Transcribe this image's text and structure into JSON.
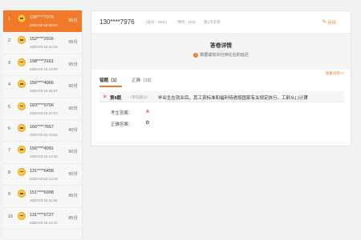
{
  "sidebar": {
    "items": [
      {
        "rank": "1",
        "phone": "130****7976",
        "date": "2020-03-15 09:03",
        "score": "95分",
        "active": true
      },
      {
        "rank": "2",
        "phone": "152****2916",
        "date": "2020-03-15 10:45",
        "score": "95分"
      },
      {
        "rank": "3",
        "phone": "198****3161",
        "date": "2020-03-15 13:09",
        "score": "95分"
      },
      {
        "rank": "4",
        "phone": "156****4966",
        "date": "2020-03-15 06:57",
        "score": "90分"
      },
      {
        "rank": "5",
        "phone": "183****9756",
        "date": "2020-03-15 10:23",
        "score": "90分"
      },
      {
        "rank": "6",
        "phone": "166****7657",
        "date": "2020-03-15 10:52",
        "score": "90分"
      },
      {
        "rank": "7",
        "phone": "156****4091",
        "date": "2020-03-15 12:40",
        "score": "90分"
      },
      {
        "rank": "8",
        "phone": "131****6458",
        "date": "2020-03-15 13:19",
        "score": "90分"
      },
      {
        "rank": "9",
        "phone": "151****6908",
        "date": "2020-03-15 11:56",
        "score": "85分"
      },
      {
        "rank": "10",
        "phone": "131****0727",
        "date": "2020-03-15 14:43",
        "score": "85分"
      }
    ]
  },
  "detail": {
    "phone": "130****7976",
    "score": "(总分：95分)",
    "time_used": "用时：10分",
    "attempt": "第1次答卷",
    "like_label": "点评",
    "title": "答卷详情",
    "notice": "数据或有30分钟左右的延迟",
    "tabs": [
      "错题（1）",
      "正确（19）"
    ],
    "view_more": "查看试卷>>",
    "question": {
      "num": "第8题",
      "type": "（单选题分）",
      "text": "毕业生在就业后，其工资标准和福利待遇按国家有关规定执行，工龄从(  )计算",
      "caret": "▾",
      "user_answer_label": "考生答案：",
      "user_answer": "A",
      "correct_answer_label": "正确答案：",
      "correct_answer": "D"
    }
  },
  "colors": {
    "accent": "#f07a2a",
    "wrong": "#e03c3c"
  }
}
